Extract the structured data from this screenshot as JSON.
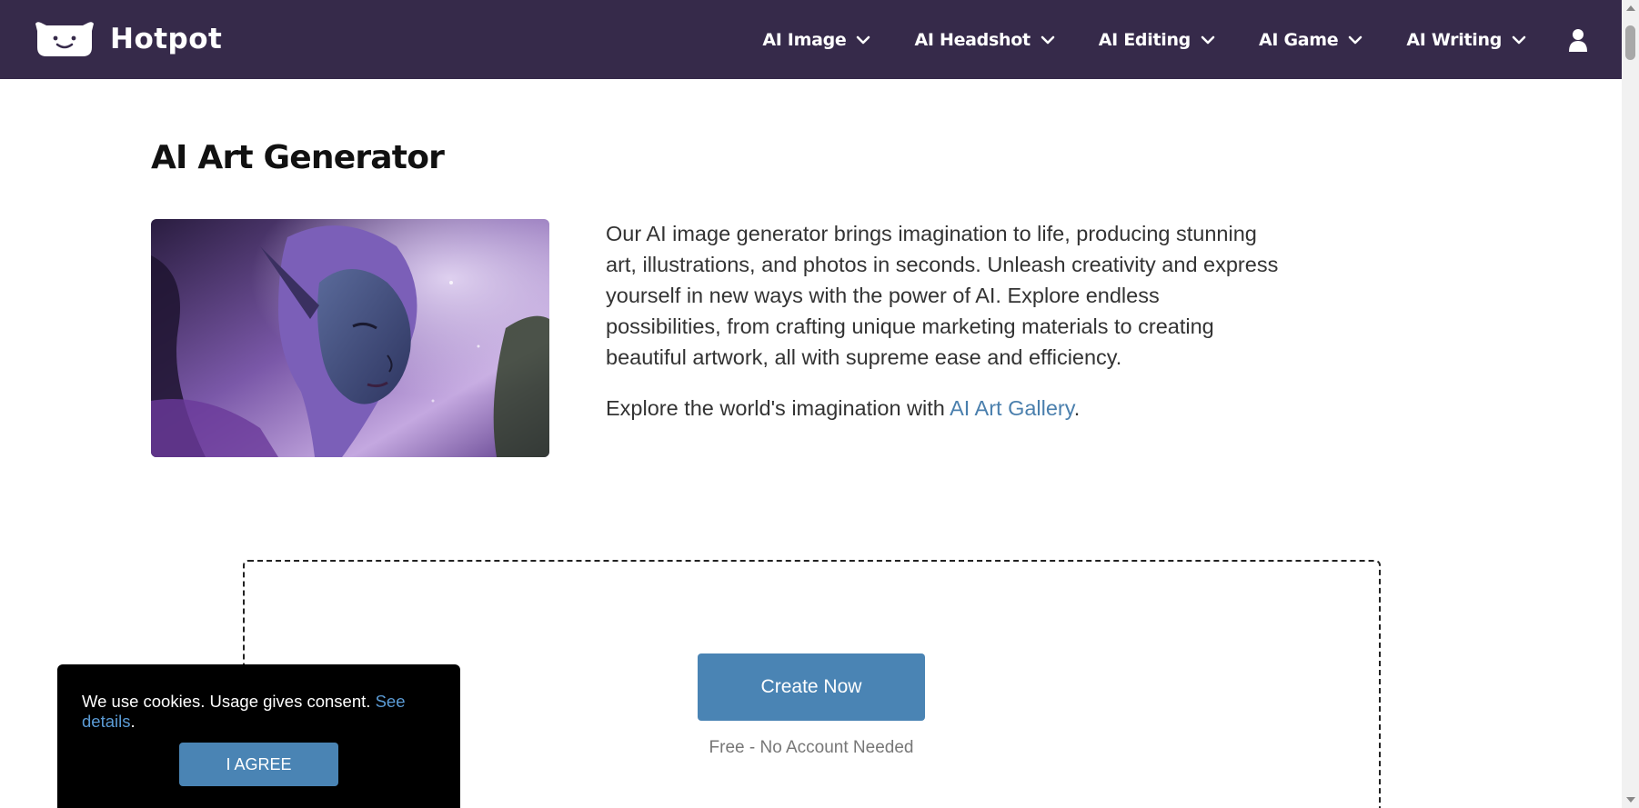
{
  "brand": {
    "name": "Hotpot"
  },
  "nav": {
    "items": [
      {
        "label": "AI Image"
      },
      {
        "label": "AI Headshot"
      },
      {
        "label": "AI Editing"
      },
      {
        "label": "AI Game"
      },
      {
        "label": "AI Writing"
      }
    ]
  },
  "main": {
    "title": "AI Art Generator",
    "intro": "Our AI image generator brings imagination to life, producing stunning art, illustrations, and photos in seconds. Unleash creativity and express yourself in new ways with the power of AI. Explore endless possibilities, from crafting unique marketing materials to creating beautiful artwork, all with supreme ease and efficiency.",
    "gallery_prefix": "Explore the world's imagination with ",
    "gallery_link": "AI Art Gallery",
    "gallery_suffix": "."
  },
  "create": {
    "button": "Create Now",
    "note": "Free - No Account Needed"
  },
  "cookie": {
    "text": "We use cookies. Usage gives consent. ",
    "link": "See details",
    "suffix": ".",
    "agree": "I AGREE"
  },
  "colors": {
    "navbar": "#362a4a",
    "accent": "#4a84b4",
    "link": "#4a7fad"
  }
}
